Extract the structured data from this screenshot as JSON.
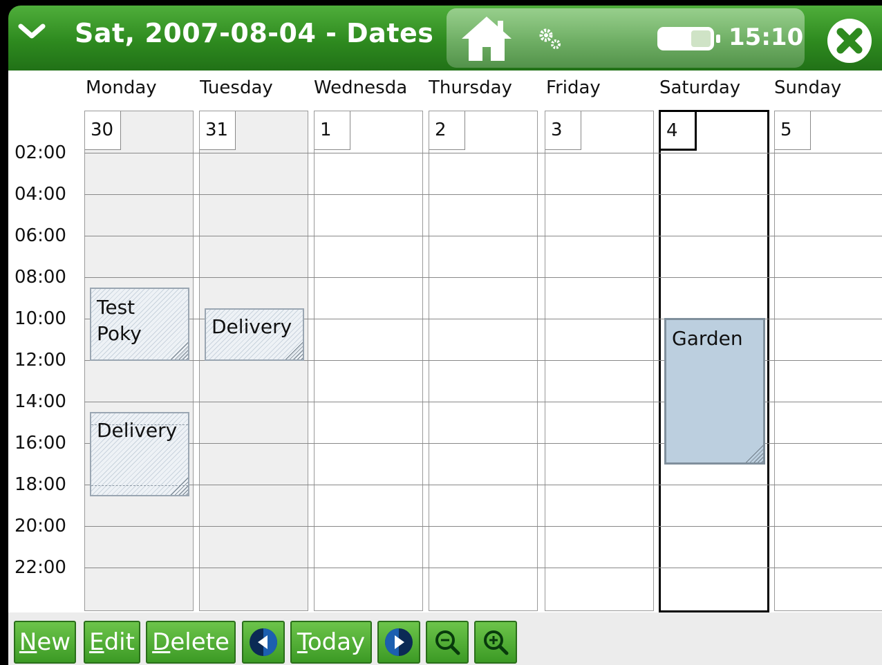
{
  "window": {
    "title": "Sat, 2007-08-04 - Dates",
    "clock": "15:10",
    "icons": [
      "chevron-down-icon",
      "home-icon",
      "gear-icon",
      "battery-icon",
      "close-icon"
    ],
    "accent_color": "#3c9a25"
  },
  "week": {
    "days": [
      {
        "name": "Monday",
        "number": "30"
      },
      {
        "name": "Tuesday",
        "number": "31"
      },
      {
        "name": "Wednesda",
        "number": "1"
      },
      {
        "name": "Thursday",
        "number": "2"
      },
      {
        "name": "Friday",
        "number": "3"
      },
      {
        "name": "Saturday",
        "number": "4"
      },
      {
        "name": "Sunday",
        "number": "5"
      }
    ],
    "selected_day": "Saturday",
    "times": [
      "02:00",
      "04:00",
      "06:00",
      "08:00",
      "10:00",
      "12:00",
      "14:00",
      "16:00",
      "18:00",
      "20:00",
      "22:00"
    ],
    "events": [
      {
        "day": "Monday",
        "label": "Test\nPoky"
      },
      {
        "day": "Tuesday",
        "label": "Delivery"
      },
      {
        "day": "Monday",
        "label": "Delivery"
      },
      {
        "day": "Saturday",
        "label": "Garden"
      }
    ]
  },
  "toolbar": {
    "new_hotkey": "N",
    "new_rest": "ew",
    "edit_hotkey": "E",
    "edit_rest": "dit",
    "delete_hotkey": "D",
    "delete_rest": "elete",
    "today_hotkey": "T",
    "today_rest": "oday",
    "icons": [
      "prev-week-icon",
      "next-week-icon",
      "zoom-out-icon",
      "zoom-in-icon"
    ]
  }
}
